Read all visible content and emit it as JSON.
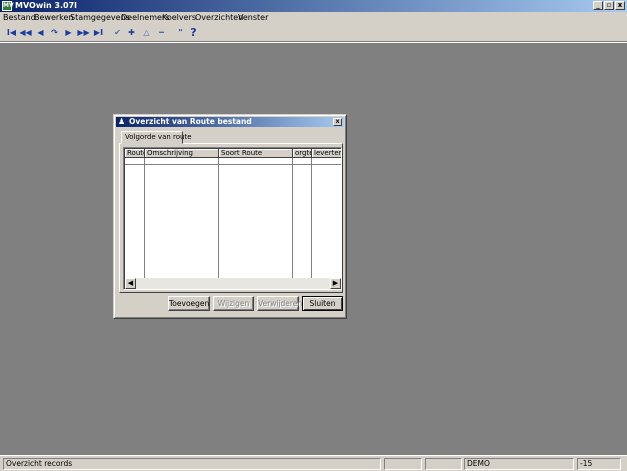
{
  "window": {
    "title": "MVOwin 3.07l",
    "icon_text": "MV",
    "controls": {
      "minimize": "_",
      "restore": "▫",
      "close": "x"
    }
  },
  "menu": {
    "items": [
      "Bestand",
      "Bewerken",
      "Stamgegevens",
      "Deelnemers",
      "Koelvers",
      "Overzichten",
      "Venster"
    ]
  },
  "toolbar": {
    "icons": [
      "first-record-icon",
      "previous-page-icon",
      "previous-record-icon",
      "refresh-icon",
      "next-record-icon",
      "next-page-icon",
      "last-record-icon",
      "confirm-icon",
      "add-icon",
      "edit-icon",
      "delete-icon",
      "quote-icon",
      "help-icon"
    ],
    "glyphs": [
      "I◀",
      "◀◀",
      "◀",
      "↷",
      "▶",
      "▶▶",
      "▶I",
      "✔",
      "✚",
      "△",
      "━",
      "\"",
      "?"
    ]
  },
  "dialog": {
    "title": "Overzicht van Route bestand",
    "close": "x",
    "tab_label": "Volgorde van route",
    "columns": [
      "Route",
      "Omschrijving",
      "Soort Route",
      "orgtemp",
      "levertemp"
    ],
    "rows": [],
    "scroll_left": "◀",
    "scroll_right": "▶",
    "buttons": {
      "add": "Toevoegen",
      "edit": "Wijzigen",
      "delete": "Verwijderen",
      "close": "Sluiten"
    }
  },
  "statusbar": {
    "message": "Overzicht records",
    "panel2": "",
    "panel3": "",
    "user": "DEMO",
    "value": "-15"
  }
}
